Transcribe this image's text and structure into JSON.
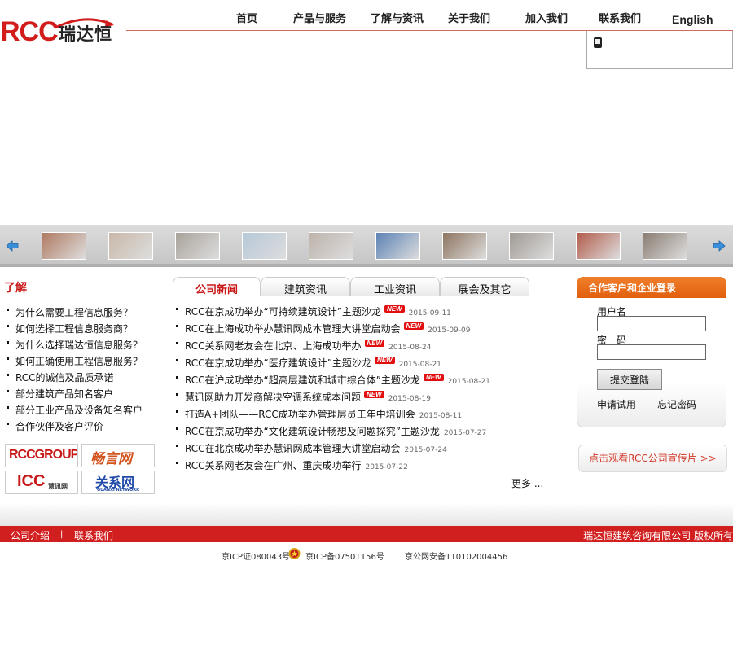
{
  "header": {
    "logo_mark": "RCC",
    "logo_name": "瑞达恒",
    "nav": [
      "首页",
      "产品与服务",
      "了解与资讯",
      "关于我们",
      "加入我们",
      "联系我们",
      "English"
    ]
  },
  "strip": {
    "left_arrow": "arrow-left-icon",
    "right_arrow": "arrow-right-icon",
    "thumb_colors": [
      "#b07a62",
      "#c9b8a8",
      "#a9a29a",
      "#b6c8d8",
      "#bdb3ab",
      "#5c82b5",
      "#8e7560",
      "#a09a94",
      "#b25b4a",
      "#8a7d72"
    ]
  },
  "left": {
    "title": "了解",
    "items": [
      "为什么需要工程信息服务？",
      "如何选择工程信息服务商？",
      "为什么选择瑞达恒信息服务？",
      "如何正确使用工程信息服务？",
      "RCC的诚信及品质承诺",
      "部分建筑产品知名客户",
      "部分工业产品及设备知名客户",
      "合作伙伴及客户评价"
    ],
    "brands": [
      "RCCGROUP",
      "畅言网",
      "ICC",
      "慧讯网",
      "关系网",
      "GUANXI NETWORK"
    ]
  },
  "news": {
    "tabs": [
      "公司新闻",
      "建筑资讯",
      "工业资讯",
      "展会及其它"
    ],
    "badge": "NEW",
    "items": [
      {
        "title": "RCC在京成功举办“可持续建筑设计”主题沙龙",
        "date": "2015-09-11",
        "new": true
      },
      {
        "title": "RCC在上海成功举办慧讯网成本管理大讲堂启动会",
        "date": "2015-09-09",
        "new": true
      },
      {
        "title": "RCC关系网老友会在北京、上海成功举办",
        "date": "2015-08-24",
        "new": true
      },
      {
        "title": "RCC在京成功举办“医疗建筑设计”主题沙龙",
        "date": "2015-08-21",
        "new": true
      },
      {
        "title": "RCC在沪成功举办“超高层建筑和城市综合体”主题沙龙",
        "date": "2015-08-21",
        "new": true
      },
      {
        "title": "慧讯网助力开发商解决空调系统成本问题",
        "date": "2015-08-19",
        "new": true
      },
      {
        "title": "打造A+团队——RCC成功举办管理层员工年中培训会",
        "date": "2015-08-11",
        "new": false
      },
      {
        "title": "RCC在京成功举办“文化建筑设计畅想及问题探究”主题沙龙",
        "date": "2015-07-27",
        "new": false
      },
      {
        "title": "RCC在北京成功举办慧讯网成本管理大讲堂启动会",
        "date": "2015-07-24",
        "new": false
      },
      {
        "title": "RCC关系网老友会在广州、重庆成功举行",
        "date": "2015-07-22",
        "new": false
      }
    ],
    "more": "更多 ..."
  },
  "login": {
    "title": "合作客户和企业登录",
    "username_label": "用户名",
    "password_label": "密　码",
    "submit": "提交登陆",
    "trial": "申请试用",
    "forgot": "忘记密码"
  },
  "promo": "点击观看RCC公司宣传片 >>",
  "footer": {
    "links": [
      "公司介绍",
      "联系我们"
    ],
    "separator": "|",
    "copyright": "瑞达恒建筑咨询有限公司 版权所有",
    "icp1": "京ICP证080043号",
    "icp2": "京ICP备07501156号",
    "icp3": "京公网安备110102004456"
  },
  "colors": {
    "brand_red": "#d11f1f",
    "login_orange": "#e8691a"
  }
}
